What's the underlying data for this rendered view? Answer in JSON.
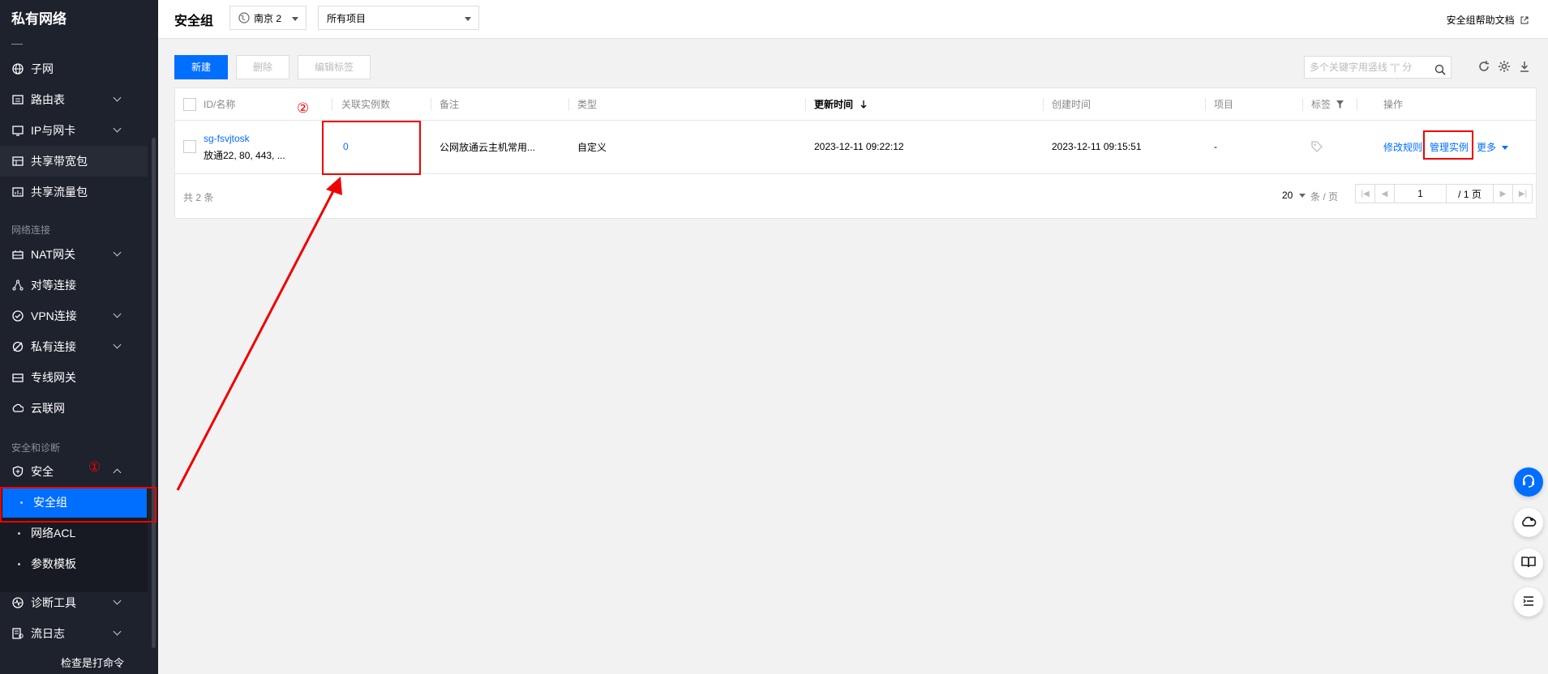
{
  "sidebar": {
    "title": "私有网络",
    "items": [
      {
        "label": "子网",
        "icon": "globe-icon"
      },
      {
        "label": "路由表",
        "icon": "route-table-icon"
      },
      {
        "label": "IP与网卡",
        "icon": "ip-card-icon"
      },
      {
        "label": "共享带宽包",
        "icon": "bandwidth-icon"
      },
      {
        "label": "共享流量包",
        "icon": "traffic-icon"
      }
    ],
    "group_network": "网络连接",
    "network_items": [
      {
        "label": "NAT网关",
        "icon": "nat-icon"
      },
      {
        "label": "对等连接",
        "icon": "peering-icon"
      },
      {
        "label": "VPN连接",
        "icon": "vpn-icon"
      },
      {
        "label": "私有连接",
        "icon": "private-link-icon"
      },
      {
        "label": "专线网关",
        "icon": "direct-gateway-icon"
      },
      {
        "label": "云联网",
        "icon": "ccn-icon"
      }
    ],
    "group_security": "安全和诊断",
    "security_label": "安全",
    "security_sub": [
      "安全组",
      "网络ACL",
      "参数模板"
    ],
    "diag_items": [
      {
        "label": "诊断工具",
        "icon": "diagnose-icon"
      },
      {
        "label": "流日志",
        "icon": "flowlog-icon"
      }
    ],
    "bottom_text": "检查是打命令"
  },
  "header": {
    "title": "安全组",
    "region": "南京 2",
    "project": "所有项目",
    "help": "安全组帮助文档"
  },
  "toolbar": {
    "new": "新建",
    "delete": "删除",
    "edit_tags": "编辑标签",
    "search_placeholder": "多个关键字用竖线 \"|\" 分"
  },
  "table": {
    "columns": [
      "ID/名称",
      "关联实例数",
      "备注",
      "类型",
      "更新时间",
      "创建时间",
      "项目",
      "标签",
      "操作"
    ],
    "rows": [
      {
        "id": "sg-fsvjtosk",
        "name": "放通22, 80, 443, ...",
        "instances": "0",
        "remark": "公网放通云主机常用...",
        "type": "自定义",
        "updated": "2023-12-11 09:22:12",
        "created": "2023-12-11 09:15:51",
        "project": "-",
        "actions": [
          "修改规则",
          "管理实例",
          "更多"
        ]
      }
    ],
    "total": "共 2 条",
    "page_size": "20",
    "page_unit": "条 / 页",
    "page_current": "1",
    "page_total": "/ 1 页"
  },
  "annotations": {
    "mark1": "①",
    "mark2": "②"
  },
  "colors": {
    "accent": "#006eff",
    "sidebar_bg": "#1e222d",
    "annotation": "#ee0000"
  }
}
